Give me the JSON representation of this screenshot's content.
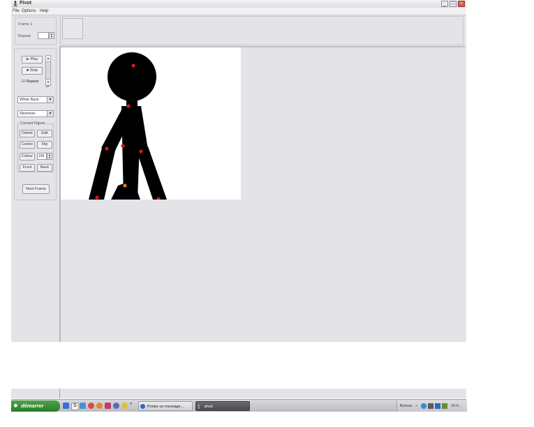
{
  "window": {
    "title": "Pivot",
    "buttons": {
      "minimize": "_",
      "maximize": "□",
      "close": "×"
    }
  },
  "menu": [
    "File",
    "Options",
    "Help"
  ],
  "frame_panel": {
    "frame_label": "Frame 1",
    "repeat_label": "Repeat",
    "repeat_value": ""
  },
  "playback": {
    "play": "Play",
    "stop": "Stop",
    "repeat_checkbox": "Repeat",
    "repeat_checked": true,
    "speed_value": "17"
  },
  "selects": {
    "mode": "White Back",
    "figure_type": "Stickman"
  },
  "current_figure": {
    "title": "Current Figure",
    "delete": "Delete",
    "edit": "Edit",
    "centre": "Centre",
    "flip": "Flip",
    "colour": "Colour",
    "size_value": "100",
    "front": "Front",
    "back": "Back"
  },
  "next_frame": "Next Frame",
  "taskbar": {
    "start": "démarrer",
    "tasks": [
      "Poster un message...",
      "pivot"
    ],
    "tray_label": "Bureau",
    "clock": "15:0..."
  },
  "colors": {
    "window_bg": "#e4e3e7",
    "stick_fill": "#000000",
    "joint_red": "#d31a1a",
    "joint_orange": "#e07a20",
    "taskbar_start": "#3a8e37"
  }
}
